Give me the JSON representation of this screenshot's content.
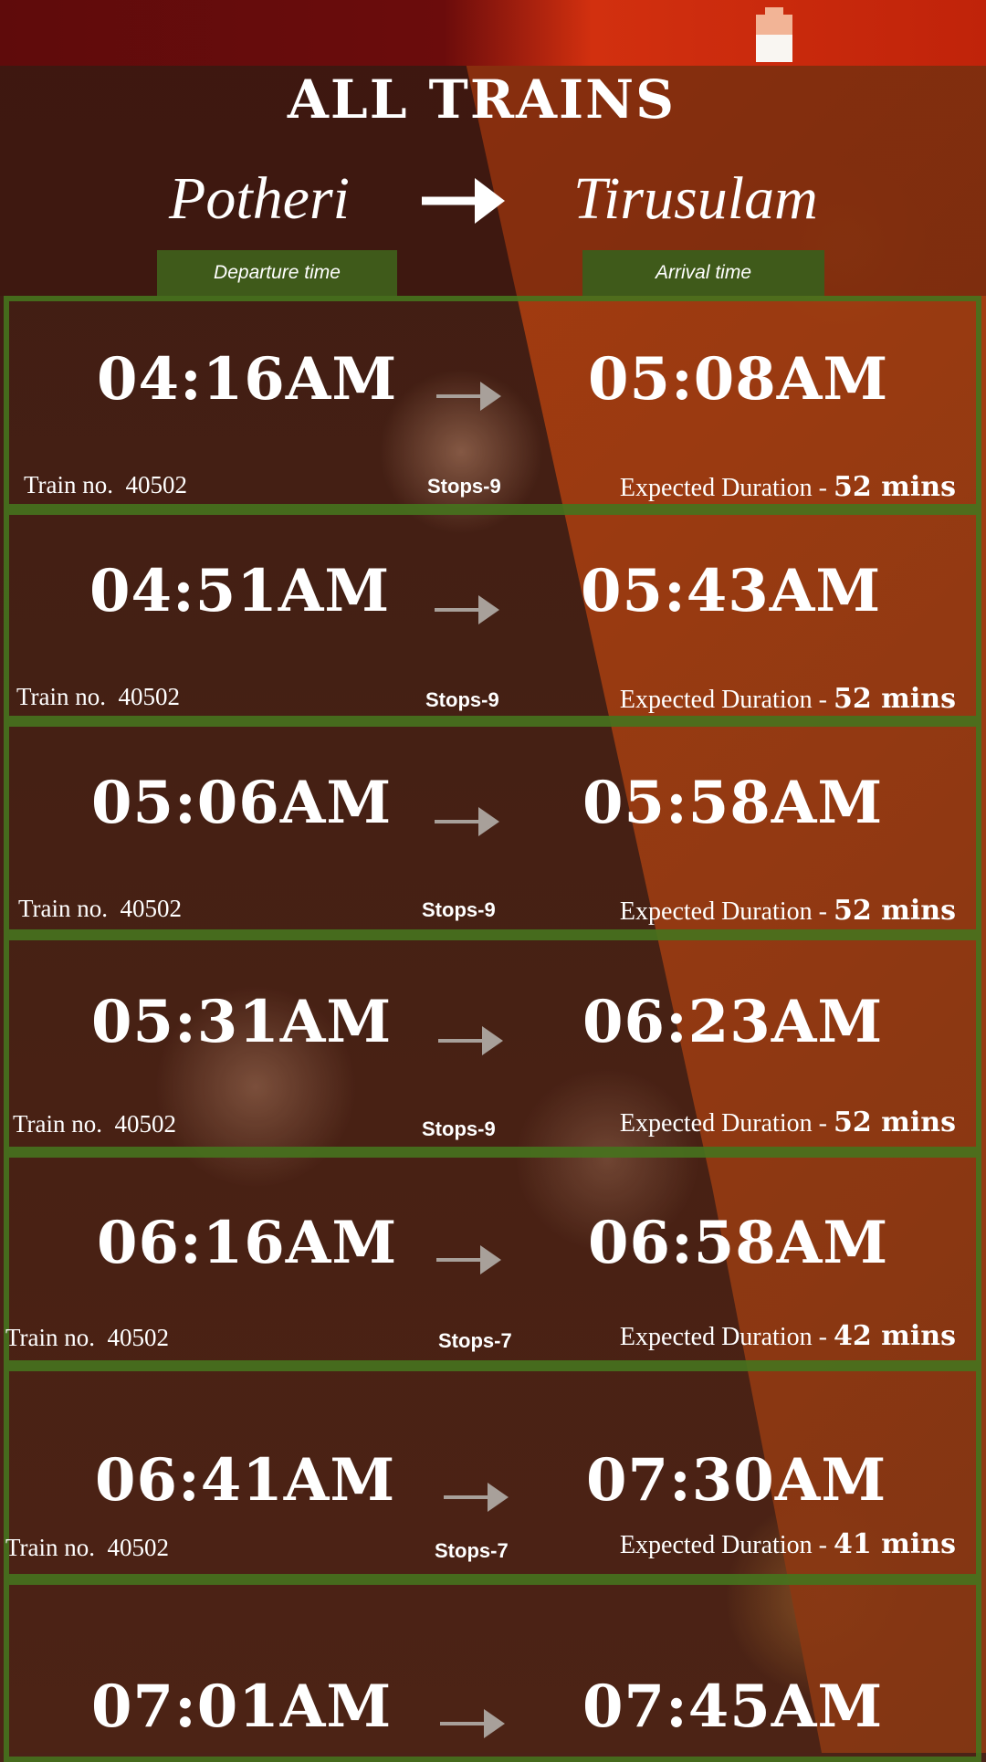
{
  "header": {
    "title": "ALL TRAINS",
    "from_station": "Potheri",
    "to_station": "Tirusulam",
    "departure_label": "Departure time",
    "arrival_label": "Arrival time"
  },
  "trains": [
    {
      "departure": "04:16AM",
      "arrival": "05:08AM",
      "train_no_label": "Train no.",
      "train_no": "40502",
      "stops_label": "Stops-",
      "stops": "9",
      "duration_label": "Expected Duration -",
      "duration": "52 mins"
    },
    {
      "departure": "04:51AM",
      "arrival": "05:43AM",
      "train_no_label": "Train no.",
      "train_no": "40502",
      "stops_label": "Stops-",
      "stops": "9",
      "duration_label": "Expected Duration -",
      "duration": "52 mins"
    },
    {
      "departure": "05:06AM",
      "arrival": "05:58AM",
      "train_no_label": "Train no.",
      "train_no": "40502",
      "stops_label": "Stops-",
      "stops": "9",
      "duration_label": "Expected Duration -",
      "duration": "52 mins"
    },
    {
      "departure": "05:31AM",
      "arrival": "06:23AM",
      "train_no_label": "Train no.",
      "train_no": "40502",
      "stops_label": "Stops-",
      "stops": "9",
      "duration_label": "Expected Duration -",
      "duration": "52 mins"
    },
    {
      "departure": "06:16AM",
      "arrival": "06:58AM",
      "train_no_label": "Train no.",
      "train_no": "40502",
      "stops_label": "Stops-",
      "stops": "7",
      "duration_label": "Expected Duration -",
      "duration": "42 mins"
    },
    {
      "departure": "06:41AM",
      "arrival": "07:30AM",
      "train_no_label": "Train no.",
      "train_no": "40502",
      "stops_label": "Stops-",
      "stops": "7",
      "duration_label": "Expected Duration -",
      "duration": "41 mins"
    },
    {
      "departure": "07:01AM",
      "arrival": "07:45AM"
    }
  ],
  "colors": {
    "row_border": "#46731e",
    "label_box": "#3f5a1a",
    "status_bar_left": "#5f0b0b",
    "status_bar_right": "#d2300f"
  },
  "icons": {
    "battery": "battery-icon",
    "route_arrow": "arrow-right-icon",
    "row_arrow": "arrow-right-icon"
  }
}
